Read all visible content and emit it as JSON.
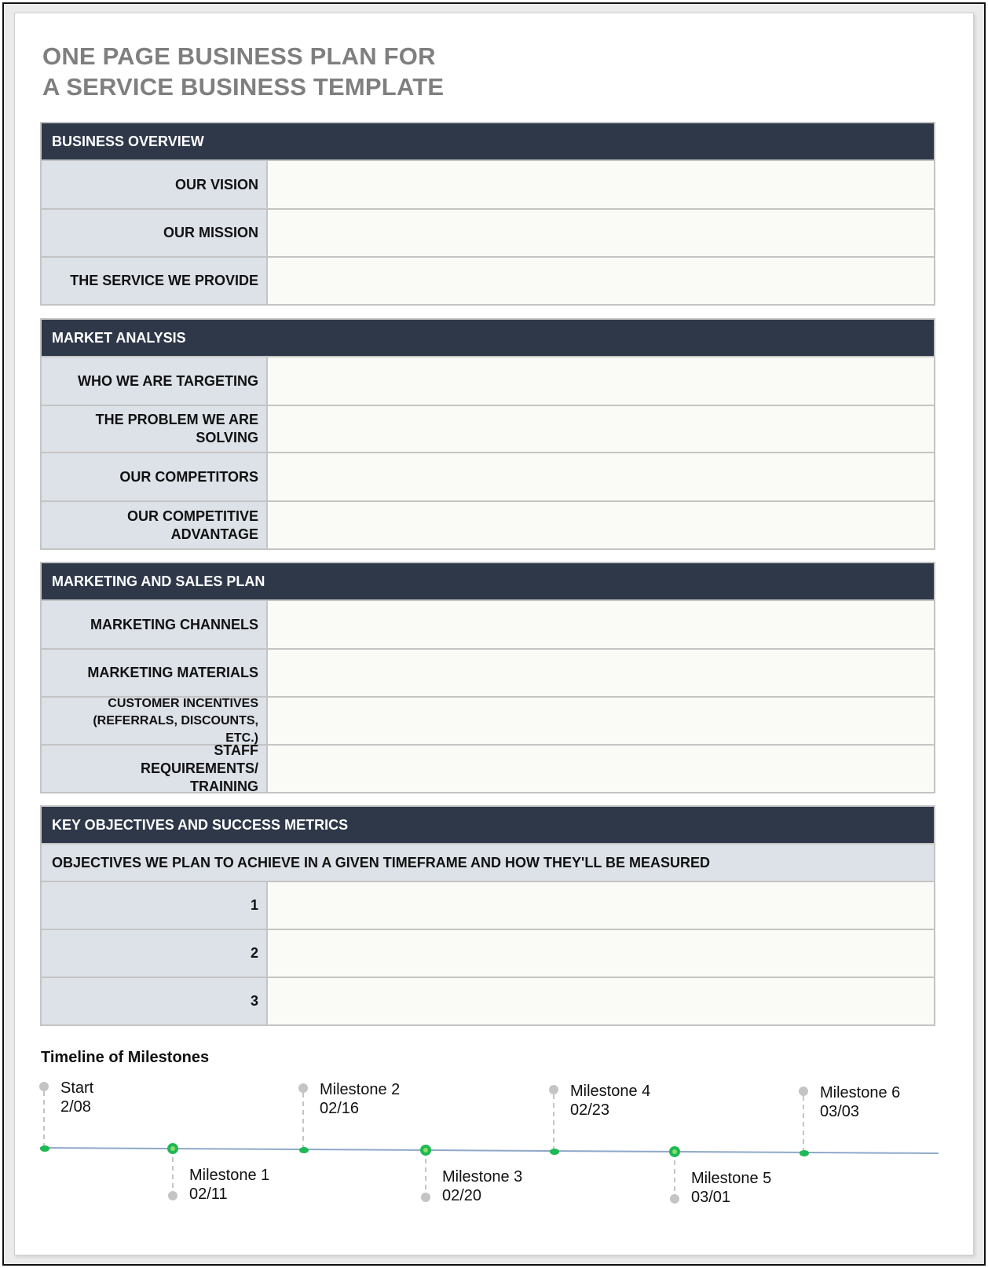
{
  "title": {
    "line1": "ONE PAGE BUSINESS PLAN FOR",
    "line2": "A SERVICE BUSINESS TEMPLATE"
  },
  "sections": [
    {
      "heading": "BUSINESS OVERVIEW",
      "rows": [
        {
          "label": "OUR VISION",
          "value": ""
        },
        {
          "label": "OUR MISSION",
          "value": ""
        },
        {
          "label": "THE SERVICE WE PROVIDE",
          "value": ""
        }
      ]
    },
    {
      "heading": "MARKET ANALYSIS",
      "rows": [
        {
          "label": "WHO WE ARE TARGETING",
          "value": ""
        },
        {
          "label": "THE PROBLEM WE ARE SOLVING",
          "value": ""
        },
        {
          "label": "OUR COMPETITORS",
          "value": ""
        },
        {
          "label": "OUR COMPETITIVE ADVANTAGE",
          "value": ""
        }
      ]
    },
    {
      "heading": "MARKETING AND SALES PLAN",
      "rows": [
        {
          "label": "MARKETING CHANNELS",
          "value": ""
        },
        {
          "label": "MARKETING MATERIALS",
          "value": ""
        },
        {
          "label": "CUSTOMER INCENTIVES (REFERRALS, DISCOUNTS, ETC.)",
          "value": ""
        },
        {
          "label": "STAFF REQUIREMENTS/ TRAINING",
          "value": ""
        }
      ]
    },
    {
      "heading": "KEY OBJECTIVES AND SUCCESS METRICS",
      "subheading": "OBJECTIVES WE PLAN TO ACHIEVE IN A GIVEN TIMEFRAME AND HOW THEY'LL BE MEASURED",
      "rows": [
        {
          "label": "1",
          "value": ""
        },
        {
          "label": "2",
          "value": ""
        },
        {
          "label": "3",
          "value": ""
        }
      ]
    }
  ],
  "timeline": {
    "title": "Timeline of Milestones",
    "milestones": [
      {
        "name": "Start",
        "date": "2/08",
        "position": "above"
      },
      {
        "name": "Milestone 1",
        "date": "02/11",
        "position": "below"
      },
      {
        "name": "Milestone 2",
        "date": "02/16",
        "position": "above"
      },
      {
        "name": "Milestone 3",
        "date": "02/20",
        "position": "below"
      },
      {
        "name": "Milestone 4",
        "date": "02/23",
        "position": "above"
      },
      {
        "name": "Milestone 5",
        "date": "03/01",
        "position": "below"
      },
      {
        "name": "Milestone 6",
        "date": "03/03",
        "position": "above"
      }
    ]
  },
  "colors": {
    "header_bg": "#2e3849",
    "label_bg": "#dde2e9",
    "value_bg": "#fafaf6",
    "title_gray": "#7f7f7f",
    "milestone_green": "#1db954",
    "connector_gray": "#c4c4c4",
    "timeline_line": "#8fa8c8"
  }
}
